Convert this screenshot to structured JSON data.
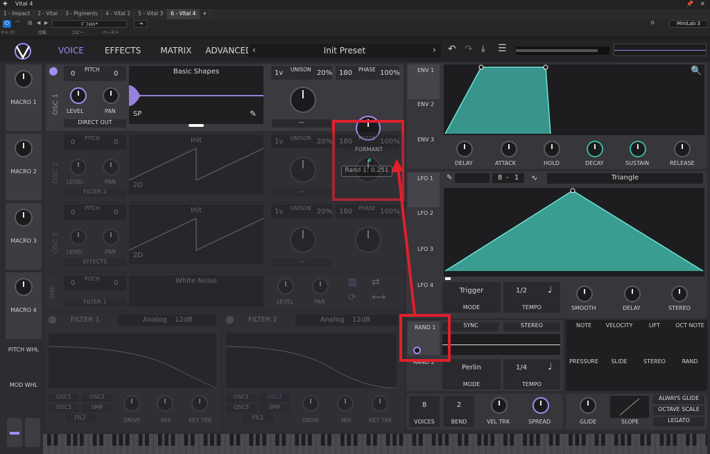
{
  "host": {
    "window_title": "Vital 4",
    "tabs": [
      "1 - Impact",
      "2 - Vital",
      "3 - Pigments",
      "4 - Vital 2",
      "5 - Vital 3",
      "6 - Vital 4"
    ],
    "active_tab": "6 - Vital 4",
    "preset_dropdown": "ﾃﾞﾌｫﾙﾄ*",
    "device": "MiniLab 3",
    "sub_labels": [
      "ｵｰﾄ: ｵﾌ",
      "比較",
      "コピー",
      "ペースト"
    ]
  },
  "nav": {
    "tabs": [
      "VOICE",
      "EFFECTS",
      "MATRIX",
      "ADVANCED"
    ],
    "active": "VOICE",
    "preset_name": "Init Preset"
  },
  "macros": [
    "MACRO 1",
    "MACRO 2",
    "MACRO 3",
    "MACRO 4"
  ],
  "wheels": [
    "PITCH WHL",
    "MOD WHL"
  ],
  "osc1": {
    "label": "OSC 1",
    "pitch_label": "PITCH",
    "pitch_left": "0",
    "pitch_right": "0",
    "wavetable": "Basic Shapes",
    "wave_mode": "SP",
    "level": "LEVEL",
    "pan": "PAN",
    "out": "DIRECT OUT",
    "unison": "UNISON",
    "voices": "1v",
    "unison_pct": "20%",
    "phase": "PHASE",
    "phase_val": "180",
    "phase_pct": "100%",
    "unison_mode": "---",
    "formant": "FORMANT",
    "tooltip": "Rand 1: 0.251"
  },
  "osc2": {
    "label": "OSC 2",
    "pitch_label": "PITCH",
    "pitch_left": "0",
    "pitch_right": "0",
    "wavetable": "Init",
    "wave_mode": "2D",
    "level": "LEVEL",
    "pan": "PAN",
    "out": "FILTER 2",
    "unison": "UNISON",
    "voices": "1v",
    "unison_pct": "20%",
    "phase": "PHASE",
    "phase_val": "180",
    "phase_pct": "100%",
    "unison_mode": "---"
  },
  "osc3": {
    "label": "OSC 3",
    "pitch_label": "PITCH",
    "pitch_left": "0",
    "pitch_right": "0",
    "wavetable": "Init",
    "wave_mode": "2D",
    "level": "LEVEL",
    "pan": "PAN",
    "out": "EFFECTS",
    "unison": "UNISON",
    "voices": "1v",
    "unison_pct": "20%",
    "phase": "PHASE",
    "phase_val": "180",
    "phase_pct": "100%",
    "unison_mode": "---"
  },
  "smp": {
    "label": "SMP",
    "pitch_label": "PITCH",
    "pitch_left": "0",
    "pitch_right": "0",
    "sample": "White Noise",
    "level": "LEVEL",
    "pan": "PAN",
    "out": "FILTER 1"
  },
  "filter1": {
    "title": "FILTER 1",
    "type": "Analog",
    "subtype": "12dB",
    "routes": [
      "OSC1",
      "OSC2",
      "OSC3",
      "SMP",
      "FIL2"
    ],
    "drive": "DRIVE",
    "mix": "MIX",
    "keytrk": "KEY TRK"
  },
  "filter2": {
    "title": "FILTER 2",
    "type": "Analog",
    "subtype": "12dB",
    "routes": [
      "OSC1",
      "OSC2",
      "OSC3",
      "SMP",
      "FIL1"
    ],
    "drive": "DRIVE",
    "mix": "MIX",
    "keytrk": "KEY TRK"
  },
  "env": {
    "tabs": [
      "ENV 1",
      "ENV 2",
      "ENV 3"
    ],
    "knobs": [
      "DELAY",
      "ATTACK",
      "HOLD",
      "DECAY",
      "SUSTAIN",
      "RELEASE"
    ]
  },
  "lfo": {
    "tabs": [
      "LFO 1",
      "LFO 2",
      "LFO 3",
      "LFO 4"
    ],
    "shape": "Triangle",
    "rate_num": "8",
    "rate_den": "1",
    "mode_val": "Trigger",
    "mode_lbl": "MODE",
    "tempo_val": "1/2",
    "tempo_lbl": "TEMPO",
    "knobs": [
      "SMOOTH",
      "DELAY",
      "STEREO"
    ]
  },
  "rand": {
    "label": "RAND 1",
    "label2": "RAND 2",
    "sync": "SYNC",
    "stereo": "STEREO",
    "mode_val": "Perlin",
    "mode_lbl": "MODE",
    "tempo_val": "1/4",
    "tempo_lbl": "TEMPO"
  },
  "sources": [
    "NOTE",
    "VELOCITY",
    "LIFT",
    "OCT NOTE",
    "PRESSURE",
    "SLIDE",
    "STEREO",
    "RAND"
  ],
  "voice": {
    "voices_val": "8",
    "voices_lbl": "VOICES",
    "bend_val": "2",
    "bend_lbl": "BEND",
    "veltrk": "VEL TRK",
    "spread": "SPREAD",
    "glide": "GLIDE",
    "slope": "SLOPE",
    "opts": [
      "ALWAYS GLIDE",
      "OCTAVE SCALE",
      "LEGATO"
    ]
  },
  "colors": {
    "accent": "#a58cf2",
    "teal": "#3eb4a6",
    "highlight": "#e0202c"
  }
}
